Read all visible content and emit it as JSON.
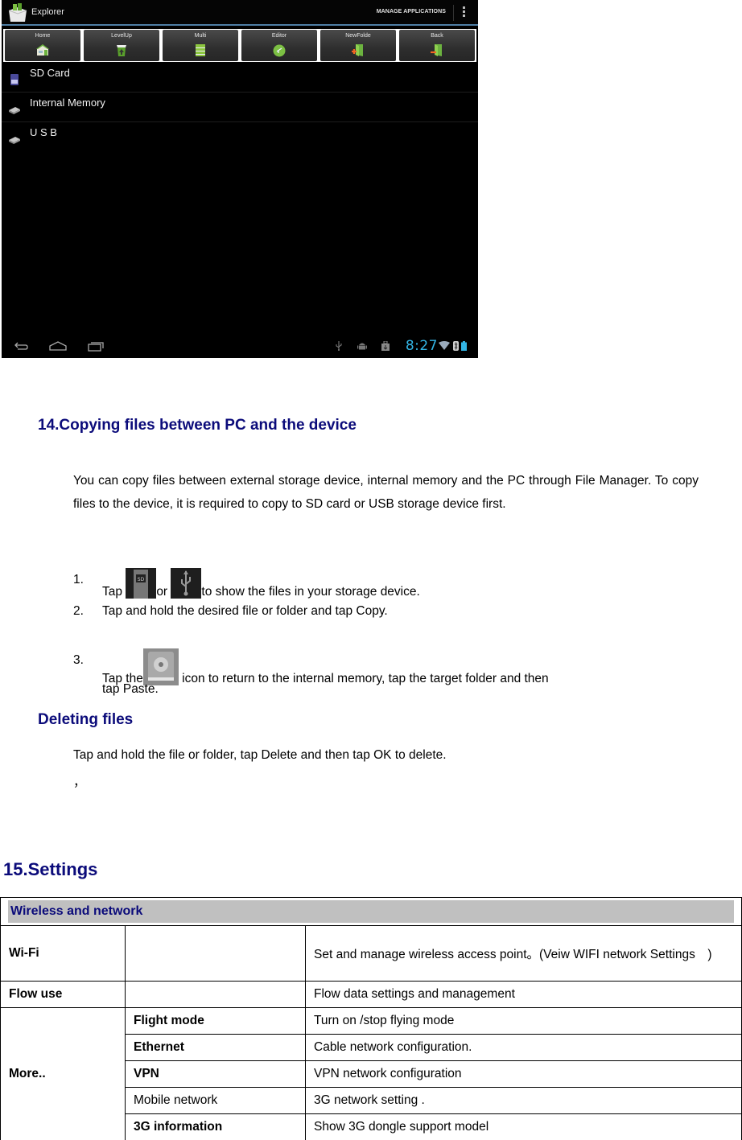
{
  "device": {
    "app_title": "Explorer",
    "action_label": "MANAGE APPLICATIONS",
    "toolbar": [
      {
        "label": "Home",
        "icon": "home-icon"
      },
      {
        "label": "LevelUp",
        "icon": "level-up-icon"
      },
      {
        "label": "Multi",
        "icon": "multi-select-icon"
      },
      {
        "label": "Editor",
        "icon": "editor-icon"
      },
      {
        "label": "NewFolde",
        "icon": "new-folder-icon"
      },
      {
        "label": "Back",
        "icon": "back-icon"
      }
    ],
    "storage": [
      {
        "label": "SD Card",
        "icon": "sd-card-icon"
      },
      {
        "label": "Internal Memory",
        "icon": "drive-icon"
      },
      {
        "label": "U S B",
        "icon": "drive-icon"
      }
    ],
    "status": {
      "time": "8:27",
      "icons": [
        "usb-debug-icon",
        "android-debug-icon",
        "download-icon",
        "wifi-icon",
        "bluetooth-icon",
        "battery-icon"
      ]
    },
    "nav": [
      "back-nav-icon",
      "home-nav-icon",
      "recents-nav-icon"
    ],
    "colors": {
      "accent": "#33b5e5",
      "bar_line": "#4f7fa6"
    }
  },
  "section14": {
    "title": "14.Copying files between PC and the device",
    "intro": "You can copy files between external storage device, internal memory and the PC through File Manager. To copy files to the device, it is required to copy to SD card or USB storage device first.",
    "steps": [
      {
        "num": "1.",
        "pre": "Tap ",
        "mid": "or ",
        "post": "to show the files in your storage device."
      },
      {
        "num": "2.",
        "text": "Tap and hold the desired file or folder and tap Copy."
      },
      {
        "num": "3.",
        "pre": "Tap the",
        "post": " icon to return to the internal memory, tap the target folder and then",
        "cont": "tap Paste."
      }
    ],
    "delete_title": "Deleting files",
    "delete_text": "Tap and hold the file or folder, tap Delete and then tap OK to delete.",
    "stray": "，"
  },
  "section15": {
    "title": "15.Settings",
    "table": {
      "header": "Wireless and network",
      "rows": [
        {
          "c1": "Wi-Fi",
          "c2": "",
          "c3": "Set and manage wireless access point。(Veiw WIFI network Settings　)"
        },
        {
          "c1": "Flow use",
          "c2": "",
          "c3": "Flow data settings and management"
        }
      ],
      "more_label": "More..",
      "more_rows": [
        {
          "c2": "Flight mode",
          "bold": true,
          "c3": "Turn on /stop flying mode"
        },
        {
          "c2": "Ethernet",
          "bold": true,
          "c3": "Cable network configuration."
        },
        {
          "c2": "VPN",
          "bold": true,
          "c3": "VPN network configuration"
        },
        {
          "c2": "Mobile network",
          "bold": false,
          "c3": "3G network setting ."
        },
        {
          "c2": "3G information",
          "bold": true,
          "c3": "Show 3G dongle support model"
        }
      ]
    },
    "colors": {
      "heading": "#0b0b7a",
      "header_bg": "#c0c0c0"
    }
  }
}
